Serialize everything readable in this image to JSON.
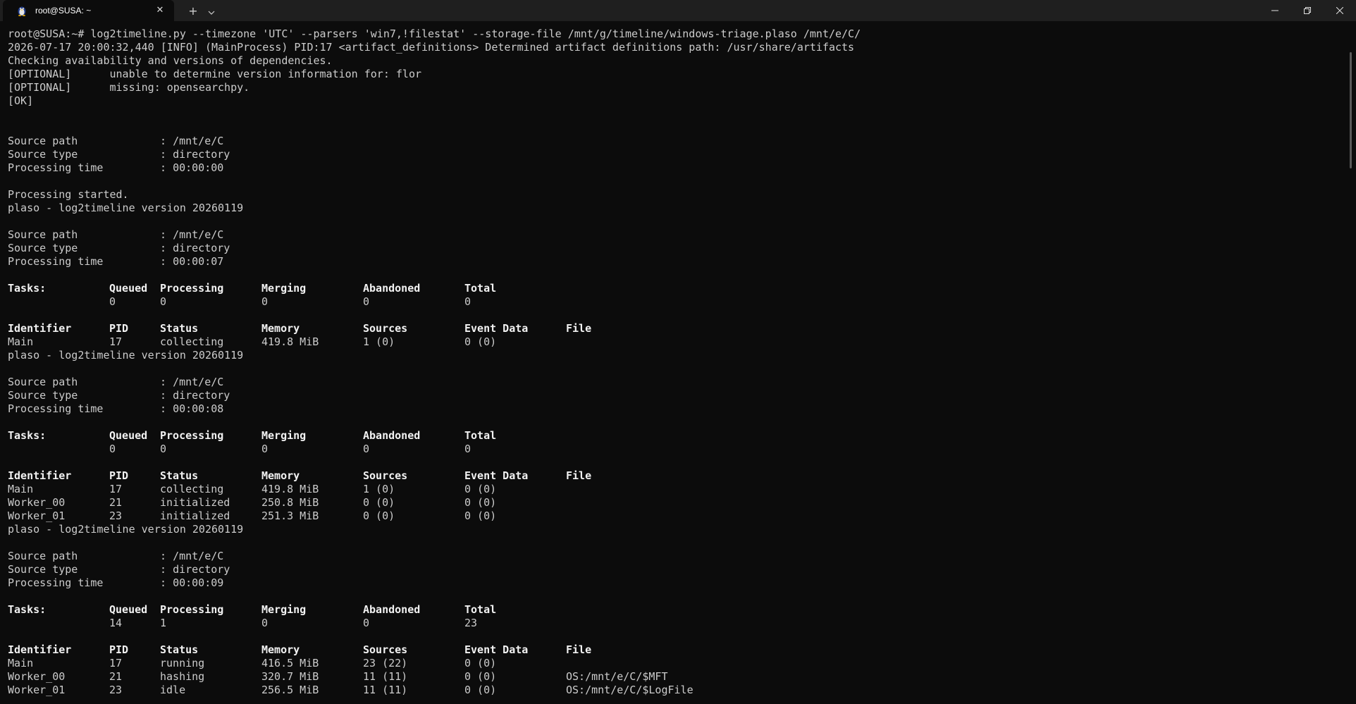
{
  "window": {
    "tab_title": "root@SUSA: ~",
    "close_tab_glyph": "✕",
    "new_tab_glyph": "+",
    "dropdown_glyph": "⌄",
    "icons": {
      "tab": "linux-penguin-icon",
      "minimize": "minimize-icon",
      "maximize": "restore-icon",
      "close": "close-icon"
    },
    "colors": {
      "background": "#0c0c0c",
      "titlebar": "#1f1f1f",
      "text": "#cccccc",
      "bold_text": "#f2f2f2"
    }
  },
  "terminal": {
    "header_lines": [
      "root@SUSA:~# log2timeline.py --timezone 'UTC' --parsers 'win7,!filestat' --storage-file /mnt/g/timeline/windows-triage.plaso /mnt/e/C/",
      "2026-07-17 20:00:32,440 [INFO] (MainProcess) PID:17 <artifact_definitions> Determined artifact definitions path: /usr/share/artifacts",
      "Checking availability and versions of dependencies.",
      "[OPTIONAL]      unable to determine version information for: flor",
      "[OPTIONAL]      missing: opensearchpy.",
      "[OK]"
    ],
    "kv_sep": ":",
    "processing_started": "Processing started.",
    "version_line": "plaso - log2timeline version 20260119",
    "source_labels": {
      "path": "Source path",
      "type": "Source type",
      "time": "Processing time"
    },
    "tasks_headers": [
      "Tasks:",
      "Queued",
      "Processing",
      "Merging",
      "Abandoned",
      "Total"
    ],
    "worker_headers": [
      "Identifier",
      "PID",
      "Status",
      "Memory",
      "Sources",
      "Event Data",
      "File"
    ],
    "initial_source": {
      "path": "/mnt/e/C",
      "type": "directory",
      "time": "00:00:00"
    },
    "blocks": [
      {
        "source": {
          "path": "/mnt/e/C",
          "type": "directory",
          "time": "00:00:07"
        },
        "tasks": [
          "",
          "0",
          "0",
          "0",
          "0",
          "0"
        ],
        "workers": [
          [
            "Main",
            "17",
            "collecting",
            "419.8 MiB",
            "1 (0)",
            "0 (0)",
            ""
          ]
        ]
      },
      {
        "source": {
          "path": "/mnt/e/C",
          "type": "directory",
          "time": "00:00:08"
        },
        "tasks": [
          "",
          "0",
          "0",
          "0",
          "0",
          "0"
        ],
        "workers": [
          [
            "Main",
            "17",
            "collecting",
            "419.8 MiB",
            "1 (0)",
            "0 (0)",
            ""
          ],
          [
            "Worker_00",
            "21",
            "initialized",
            "250.8 MiB",
            "0 (0)",
            "0 (0)",
            ""
          ],
          [
            "Worker_01",
            "23",
            "initialized",
            "251.3 MiB",
            "0 (0)",
            "0 (0)",
            ""
          ]
        ]
      },
      {
        "source": {
          "path": "/mnt/e/C",
          "type": "directory",
          "time": "00:00:09"
        },
        "tasks": [
          "",
          "14",
          "1",
          "0",
          "0",
          "23"
        ],
        "workers": [
          [
            "Main",
            "17",
            "running",
            "416.5 MiB",
            "23 (22)",
            "0 (0)",
            ""
          ],
          [
            "Worker_00",
            "21",
            "hashing",
            "320.7 MiB",
            "11 (11)",
            "0 (0)",
            "OS:/mnt/e/C/$MFT"
          ],
          [
            "Worker_01",
            "23",
            "idle",
            "256.5 MiB",
            "11 (11)",
            "0 (0)",
            "OS:/mnt/e/C/$LogFile"
          ]
        ]
      }
    ]
  }
}
